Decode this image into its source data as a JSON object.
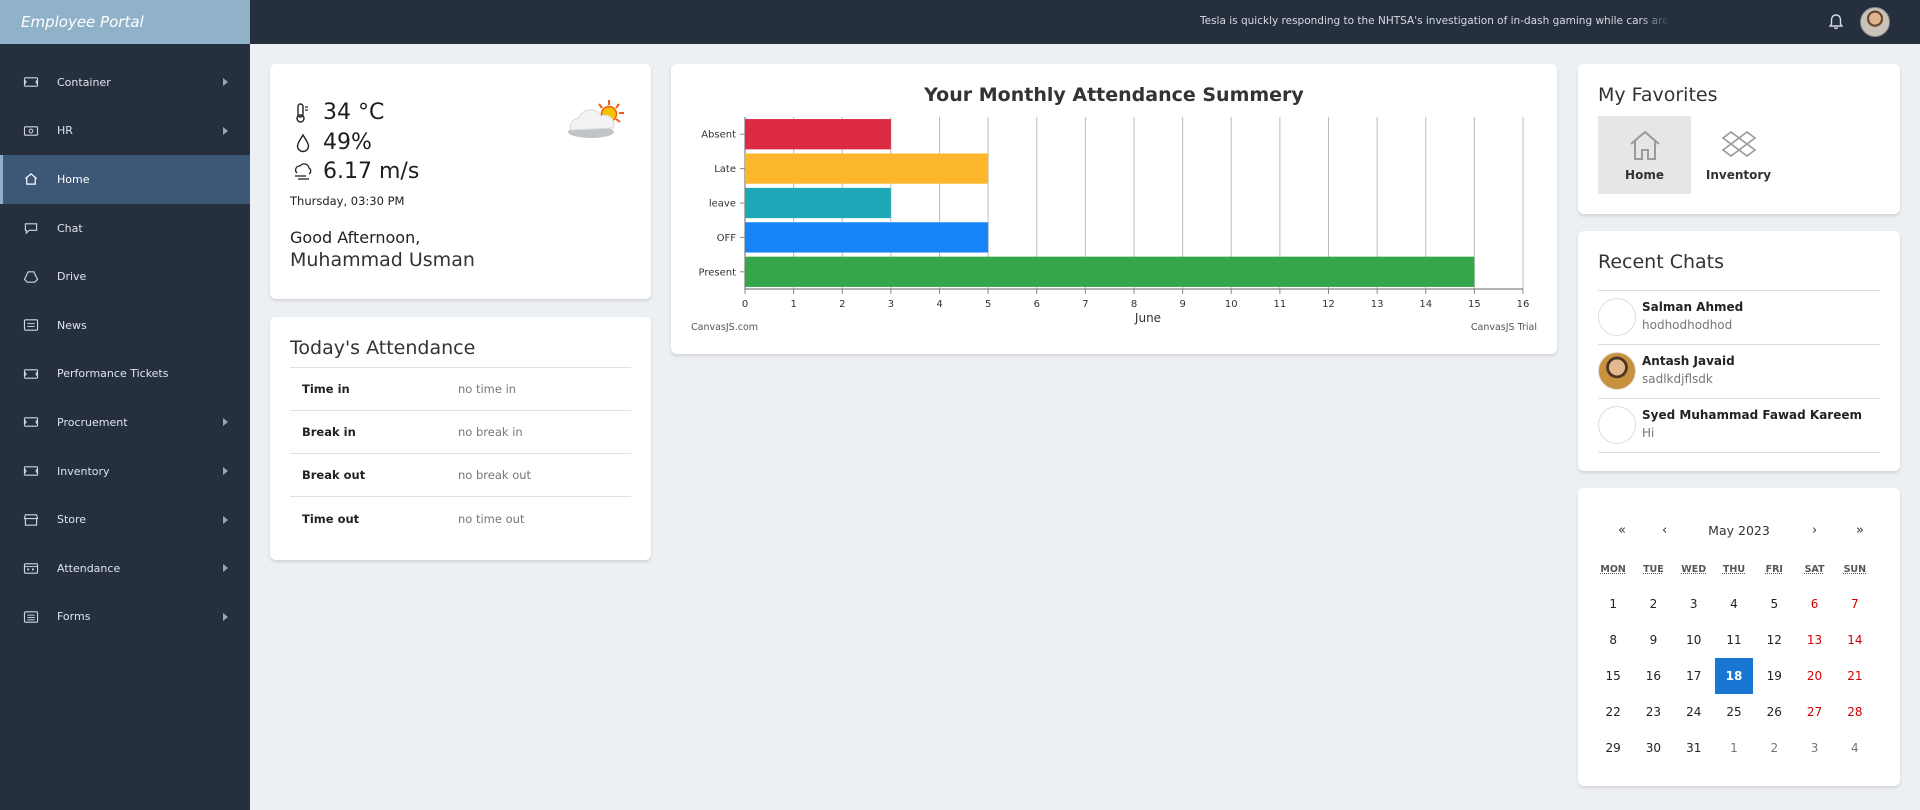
{
  "app": {
    "title": "Employee Portal"
  },
  "sidebar": {
    "items": [
      {
        "label": "Container",
        "icon": "ticket-icon",
        "has_submenu": true,
        "active": false
      },
      {
        "label": "HR",
        "icon": "money-icon",
        "has_submenu": true,
        "active": false
      },
      {
        "label": "Home",
        "icon": "home-icon",
        "has_submenu": false,
        "active": true
      },
      {
        "label": "Chat",
        "icon": "chat-icon",
        "has_submenu": false,
        "active": false
      },
      {
        "label": "Drive",
        "icon": "drive-icon",
        "has_submenu": false,
        "active": false
      },
      {
        "label": "News",
        "icon": "news-icon",
        "has_submenu": false,
        "active": false
      },
      {
        "label": "Performance Tickets",
        "icon": "ticket-icon",
        "has_submenu": false,
        "active": false
      },
      {
        "label": "Procruement",
        "icon": "ticket-icon",
        "has_submenu": true,
        "active": false
      },
      {
        "label": "Inventory",
        "icon": "ticket-icon",
        "has_submenu": true,
        "active": false
      },
      {
        "label": "Store",
        "icon": "store-icon",
        "has_submenu": true,
        "active": false
      },
      {
        "label": "Attendance",
        "icon": "calendar-icon",
        "has_submenu": true,
        "active": false
      },
      {
        "label": "Forms",
        "icon": "form-icon",
        "has_submenu": true,
        "active": false
      }
    ]
  },
  "topbar": {
    "ticker": "Tesla is quickly responding to the NHTSA's investigation of in-dash gaming while cars are moving. The Guardian ha"
  },
  "weather": {
    "temperature": "34 °C",
    "humidity": "49%",
    "wind": "6.17 m/s",
    "datetime": "Thursday, 03:30 PM",
    "greeting": "Good Afternoon,",
    "name": "Muhammad Usman"
  },
  "attendance": {
    "title": "Today's Attendance",
    "rows": [
      {
        "label": "Time in",
        "value": "no time in"
      },
      {
        "label": "Break in",
        "value": "no break in"
      },
      {
        "label": "Break out",
        "value": "no break out"
      },
      {
        "label": "Time out",
        "value": "no time out"
      }
    ]
  },
  "chart_data": {
    "type": "bar",
    "orientation": "horizontal",
    "title": "Your Monthly Attendance Summery",
    "xlabel": "June",
    "ylabel": "",
    "categories": [
      "Absent",
      "Late",
      "leave",
      "OFF",
      "Present"
    ],
    "values": [
      3,
      5,
      3,
      5,
      15
    ],
    "colors": [
      "#dc2a45",
      "#fdb72c",
      "#1fa8b8",
      "#1785f7",
      "#36a64a"
    ],
    "xlim": [
      0,
      16
    ],
    "xticks": [
      0,
      1,
      2,
      3,
      4,
      5,
      6,
      7,
      8,
      9,
      10,
      11,
      12,
      13,
      14,
      15,
      16
    ],
    "grid": true,
    "credit_left": "CanvasJS.com",
    "credit_right": "CanvasJS Trial"
  },
  "favorites": {
    "title": "My Favorites",
    "items": [
      {
        "label": "Home",
        "icon": "home-icon",
        "selected": true
      },
      {
        "label": "Inventory",
        "icon": "dropbox-icon",
        "selected": false
      }
    ]
  },
  "recent_chats": {
    "title": "Recent Chats",
    "items": [
      {
        "name": "Salman Ahmed",
        "message": "hodhodhodhod",
        "has_photo": false
      },
      {
        "name": "Antash Javaid",
        "message": "sadlkdjflsdk",
        "has_photo": true
      },
      {
        "name": "Syed Muhammad Fawad Kareem",
        "message": "Hi",
        "has_photo": false
      }
    ]
  },
  "calendar": {
    "month_label": "May 2023",
    "nav": {
      "prev_year": "«",
      "prev_month": "‹",
      "next_month": "›",
      "next_year": "»"
    },
    "weekdays": [
      "MON",
      "TUE",
      "WED",
      "THU",
      "FRI",
      "SAT",
      "SUN"
    ],
    "days": [
      [
        "1",
        "2",
        "3",
        "4",
        "5",
        "6",
        "7"
      ],
      [
        "8",
        "9",
        "10",
        "11",
        "12",
        "13",
        "14"
      ],
      [
        "15",
        "16",
        "17",
        "18",
        "19",
        "20",
        "21"
      ],
      [
        "22",
        "23",
        "24",
        "25",
        "26",
        "27",
        "28"
      ],
      [
        "29",
        "30",
        "31",
        "1",
        "2",
        "3",
        "4"
      ]
    ],
    "selected_day": "18",
    "other_month_from": 31,
    "weekend_color": "#d10000",
    "selected_color": "#1976d2"
  }
}
